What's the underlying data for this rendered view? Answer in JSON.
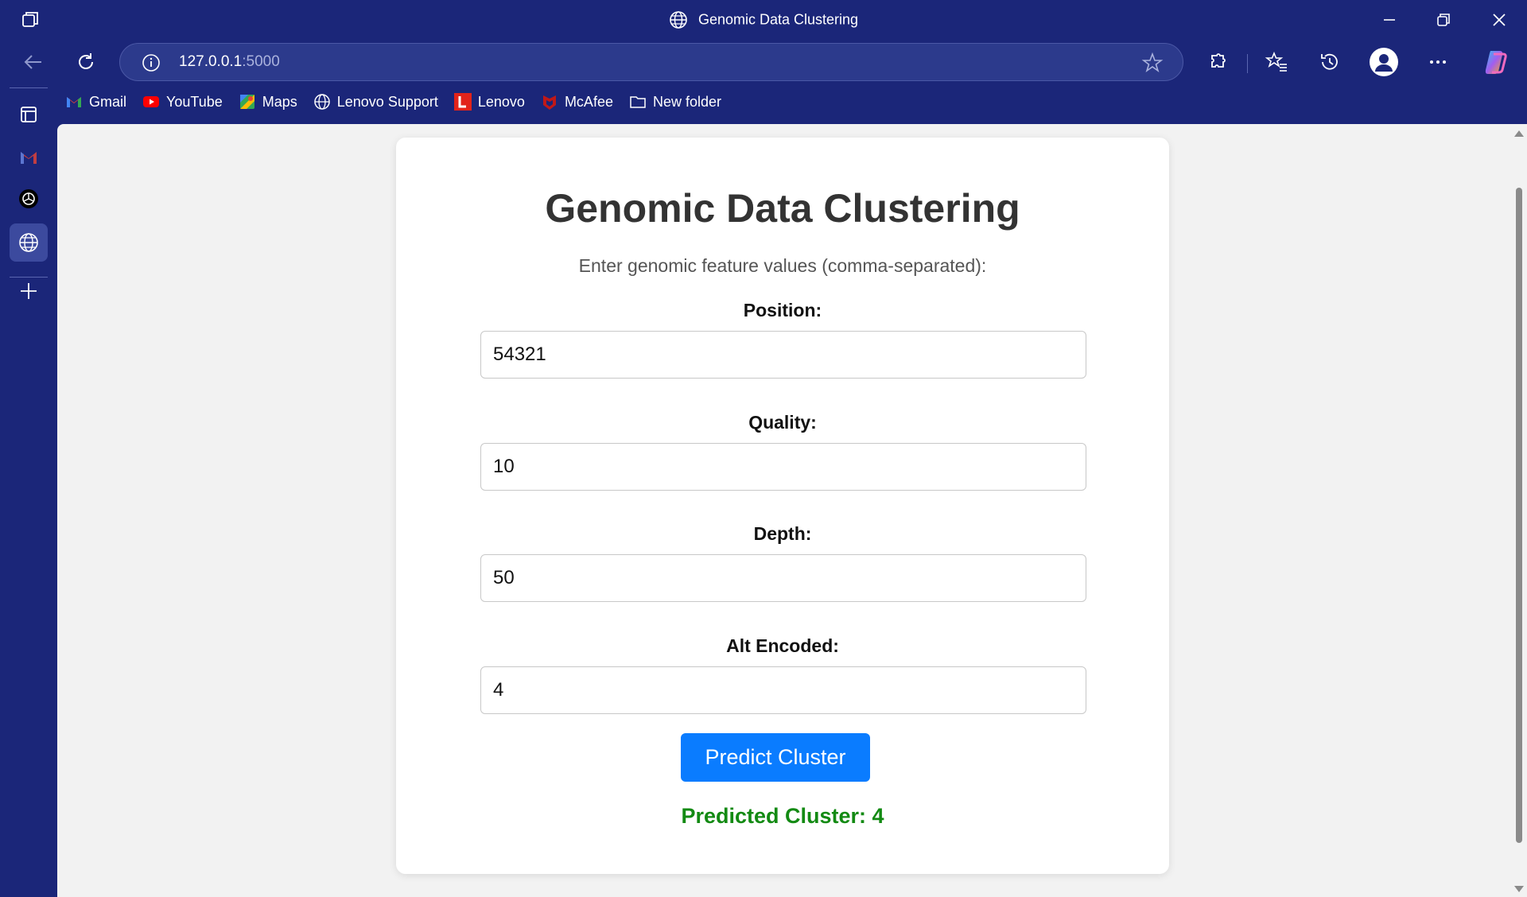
{
  "window": {
    "title": "Genomic Data Clustering"
  },
  "address_bar": {
    "host": "127.0.0.1",
    "port": ":5000"
  },
  "bookmarks": [
    {
      "label": "Gmail",
      "icon": "gmail-icon"
    },
    {
      "label": "YouTube",
      "icon": "youtube-icon"
    },
    {
      "label": "Maps",
      "icon": "maps-icon"
    },
    {
      "label": "Lenovo Support",
      "icon": "globe-icon"
    },
    {
      "label": "Lenovo",
      "icon": "lenovo-icon"
    },
    {
      "label": "McAfee",
      "icon": "mcafee-icon"
    },
    {
      "label": "New folder",
      "icon": "folder-icon"
    }
  ],
  "page": {
    "heading": "Genomic Data Clustering",
    "subtitle": "Enter genomic feature values (comma-separated):",
    "fields": [
      {
        "label": "Position:",
        "value": "54321"
      },
      {
        "label": "Quality:",
        "value": "10"
      },
      {
        "label": "Depth:",
        "value": "50"
      },
      {
        "label": "Alt Encoded:",
        "value": "4"
      }
    ],
    "button_label": "Predict Cluster",
    "result": "Predicted Cluster: 4"
  },
  "colors": {
    "chrome": "#1b2679",
    "button": "#0a7cff",
    "result": "#138a13"
  }
}
